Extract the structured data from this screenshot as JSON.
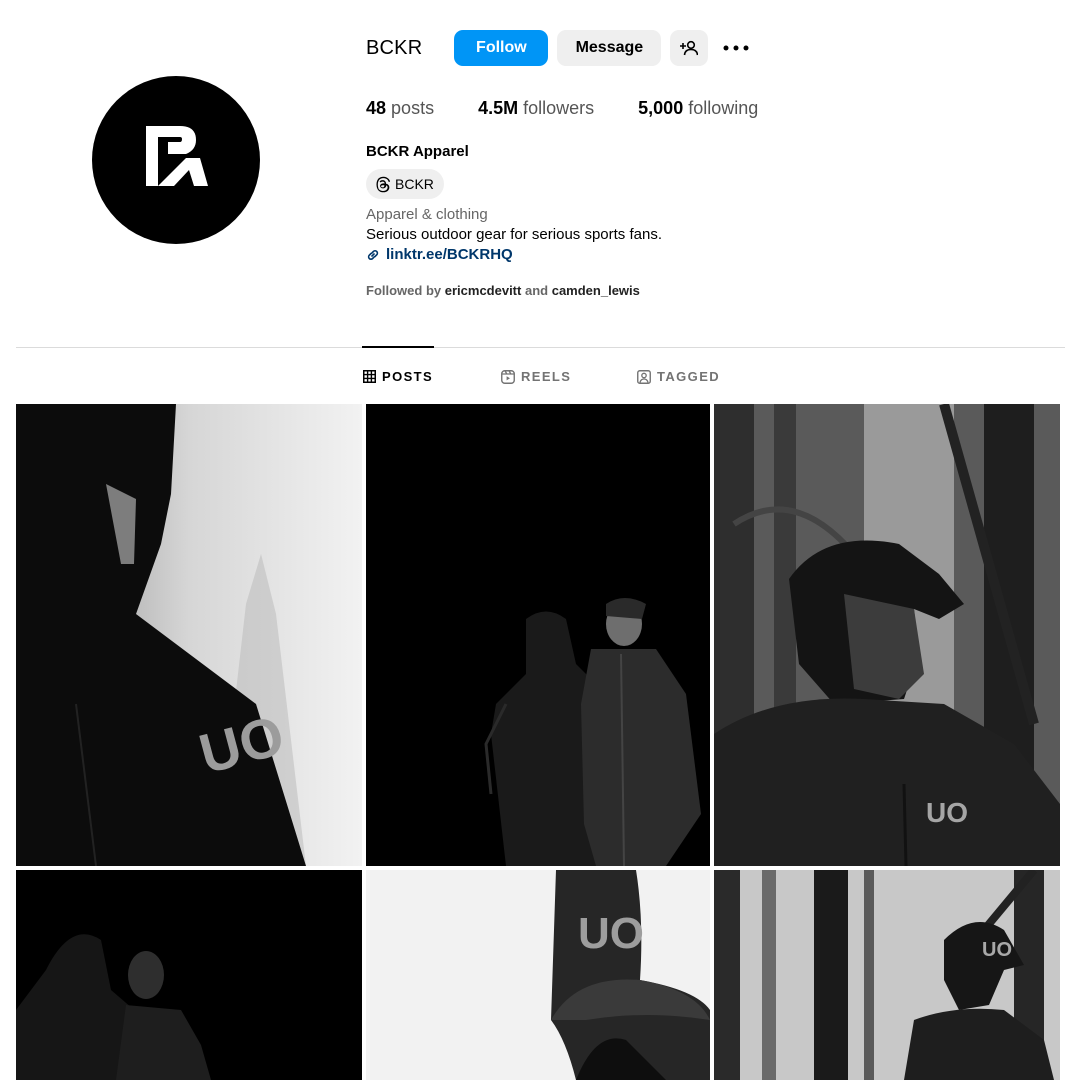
{
  "profile": {
    "username": "BCKR",
    "follow_label": "Follow",
    "message_label": "Message",
    "avatar_icon": "bckr-logo",
    "add_user_icon": "add-person-icon",
    "more_icon": "more-options-icon"
  },
  "stats": {
    "posts_count": "48",
    "posts_label": "posts",
    "followers_count": "4.5M",
    "followers_label": "followers",
    "following_count": "5,000",
    "following_label": "following"
  },
  "bio": {
    "full_name": "BCKR Apparel",
    "threads_handle": "BCKR",
    "category": "Apparel & clothing",
    "description": "Serious outdoor gear for serious sports fans.",
    "link": "linktr.ee/BCKRHQ",
    "followed_by_prefix": "Followed by",
    "followed_by_1": "ericmcdevitt",
    "followed_by_and": "and",
    "followed_by_2": "camden_lewis"
  },
  "tabs": [
    {
      "label": "POSTS",
      "icon": "grid-icon",
      "active": true
    },
    {
      "label": "REELS",
      "icon": "reels-icon",
      "active": false
    },
    {
      "label": "TAGGED",
      "icon": "tagged-icon",
      "active": false
    }
  ],
  "posts": [
    {
      "description": "Black and white close-up of person in hood with UO logo jacket, foggy forest"
    },
    {
      "description": "Two people in dark jackets standing in darkness"
    },
    {
      "description": "Man in cap and jacket with UO logo in forest"
    },
    {
      "description": "Person in shadow, dark background"
    },
    {
      "description": "Cap with UO logo against bright sky"
    },
    {
      "description": "Man in UO cap in misty forest"
    }
  ],
  "colors": {
    "accent": "#0095f6",
    "button_gray": "#efefef",
    "link": "#00376b",
    "muted": "#737373",
    "divider": "#dbdbdb"
  }
}
